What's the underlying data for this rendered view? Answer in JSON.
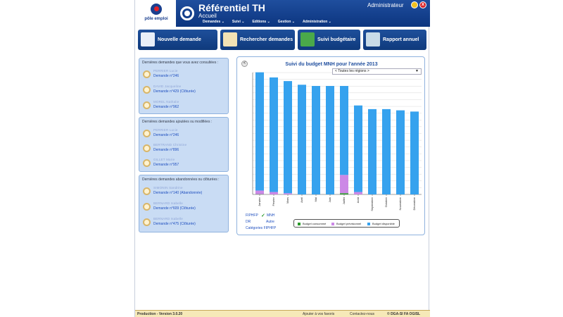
{
  "header": {
    "logo_text": "pôle emploi",
    "title": "Référentiel TH",
    "subtitle": "Accueil",
    "user": "Administrateur",
    "close_glyph": "x"
  },
  "menu": [
    "Demandes",
    "Suivi",
    "Editions",
    "Gestion",
    "Administration"
  ],
  "actions": [
    {
      "label": "Nouvelle demande",
      "icon": "form-icon"
    },
    {
      "label": "Rechercher demandes",
      "icon": "search-user-icon"
    },
    {
      "label": "Suivi budgétaire",
      "icon": "euro-icon"
    },
    {
      "label": "Rapport annuel",
      "icon": "report-icon"
    }
  ],
  "panels": [
    {
      "title": "Dernières demandes que vous avez consultées :",
      "items": [
        {
          "name": "PERRIER Lucie",
          "link": "Demande n°246"
        },
        {
          "name": "DAVID Jacqueline",
          "link": "Demande n°429 (Clôturée)"
        },
        {
          "name": "MOREL Nathalie",
          "link": "Demande n°962"
        }
      ]
    },
    {
      "title": "Dernières demandes ajoutées ou modifiées :",
      "items": [
        {
          "name": "PERRIER Lucie",
          "link": "Demande n°246"
        },
        {
          "name": "BERTRAND Christine",
          "link": "Demande n°896"
        },
        {
          "name": "GILLET Marie",
          "link": "Demande n°957"
        }
      ]
    },
    {
      "title": "Dernières demandes abandonnées ou clôturées :",
      "items": [
        {
          "name": "SIMONIN Sandrine",
          "link": "Demande n°140 (Abandonnée)"
        },
        {
          "name": "BERNARD Isabelle",
          "link": "Demande n°609 (Clôturée)"
        },
        {
          "name": "BERNARD Isabelle",
          "link": "Demande n°475 (Clôturée)"
        }
      ]
    }
  ],
  "chart_panel": {
    "back_glyph": "<",
    "region_select": "< Toutes les régions >",
    "links": {
      "fiphfp": "FIPHFP",
      "mnh": "MNH",
      "dr": "DR",
      "autre": "Autre",
      "categories": "Catégories FIPHFP"
    }
  },
  "chart_data": {
    "type": "bar",
    "stacked": true,
    "title": "Suivi du budget MNH pour l'année 2013",
    "categories": [
      "Janvier",
      "Février",
      "Mars",
      "Avril",
      "Mai",
      "Juin",
      "Juillet",
      "Août",
      "Septembre",
      "Octobre",
      "Novembre",
      "Décembre"
    ],
    "series": [
      {
        "name": "Budget consommé",
        "color": "#2a9a2a",
        "values": [
          0.2,
          0,
          0,
          0,
          0,
          0,
          1,
          0,
          0,
          0,
          0,
          0
        ]
      },
      {
        "name": "Budget prévisionnel",
        "color": "#cc88e6",
        "values": [
          3,
          2,
          1,
          0,
          0,
          0,
          15,
          2,
          0,
          0,
          0,
          0
        ]
      },
      {
        "name": "Budget disponible",
        "color": "#36a2ee",
        "values": [
          97,
          94,
          92,
          90,
          89,
          89,
          73,
          71,
          70,
          70,
          69,
          68
        ]
      }
    ],
    "ylim": [
      0,
      100
    ],
    "grid": true,
    "legend": "bottom"
  },
  "footer": {
    "version": "Production - Version 3.0.20",
    "favorites": "Ajouter à vos favoris",
    "contact": "Contactez-nous",
    "copyright": "© DGA-SI FA OGISL"
  },
  "colors": {
    "header": "#1a4690",
    "panel_bg": "#c9dcf4",
    "link": "#1f4fbf",
    "footer_bg": "#f6e9b8"
  }
}
